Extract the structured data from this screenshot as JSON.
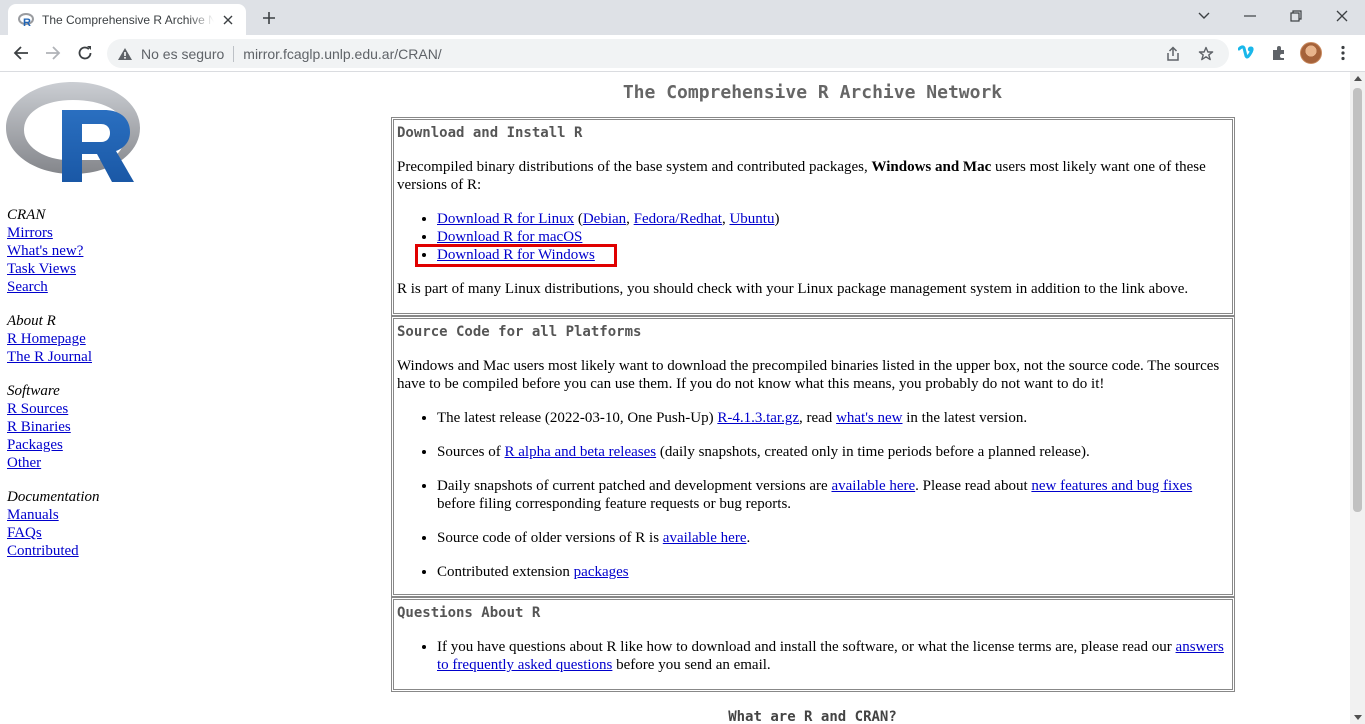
{
  "browser": {
    "tab_title": "The Comprehensive R Archive Network",
    "security_label": "No es seguro",
    "url": "mirror.fcaglp.unlp.edu.ar/CRAN/"
  },
  "sidebar": {
    "cran": {
      "title": "CRAN",
      "links": [
        "Mirrors",
        "What's new?",
        "Task Views",
        "Search"
      ]
    },
    "about": {
      "title": "About R",
      "links": [
        "R Homepage",
        "The R Journal"
      ]
    },
    "software": {
      "title": "Software",
      "links": [
        "R Sources",
        "R Binaries",
        "Packages",
        "Other"
      ]
    },
    "documentation": {
      "title": "Documentation",
      "links": [
        "Manuals",
        "FAQs",
        "Contributed"
      ]
    }
  },
  "main": {
    "title": "The Comprehensive R Archive Network",
    "download": {
      "heading": "Download and Install R",
      "intro_1": "Precompiled binary distributions of the base system and contributed packages, ",
      "intro_bold": "Windows and Mac",
      "intro_2": " users most likely want one of these versions of R:",
      "linux_link": "Download R for Linux",
      "linux_paren_open": " (",
      "debian": "Debian",
      "comma1": ", ",
      "fedora": "Fedora/Redhat",
      "comma2": ", ",
      "ubuntu": "Ubuntu",
      "paren_close": ")",
      "macos_link": "Download R for macOS",
      "windows_link": "Download R for Windows",
      "note": "R is part of many Linux distributions, you should check with your Linux package management system in addition to the link above."
    },
    "source": {
      "heading": "Source Code for all Platforms",
      "intro": "Windows and Mac users most likely want to download the precompiled binaries listed in the upper box, not the source code. The sources have to be compiled before you can use them. If you do not know what this means, you probably do not want to do it!",
      "item1_a": "The latest release (2022-03-10, One Push-Up) ",
      "item1_link1": "R-4.1.3.tar.gz",
      "item1_b": ", read ",
      "item1_link2": "what's new",
      "item1_c": " in the latest version.",
      "item2_a": "Sources of ",
      "item2_link": "R alpha and beta releases",
      "item2_b": " (daily snapshots, created only in time periods before a planned release).",
      "item3_a": "Daily snapshots of current patched and development versions are ",
      "item3_link1": "available here",
      "item3_b": ". Please read about ",
      "item3_link2": "new features and bug fixes",
      "item3_c": " before filing corresponding feature requests or bug reports.",
      "item4_a": "Source code of older versions of R is ",
      "item4_link": "available here",
      "item4_b": ".",
      "item5_a": "Contributed extension ",
      "item5_link": "packages"
    },
    "questions": {
      "heading": "Questions About R",
      "item_a": "If you have questions about R like how to download and install the software, or what the license terms are, please read our ",
      "item_link": "answers to frequently asked questions",
      "item_b": " before you send an email."
    },
    "bottom_heading": "What are R and CRAN?"
  },
  "colors": {
    "link": "#0000cc",
    "highlight": "#e00000",
    "r_blue": "#2165b6",
    "r_gray": "#9a9ca0"
  }
}
